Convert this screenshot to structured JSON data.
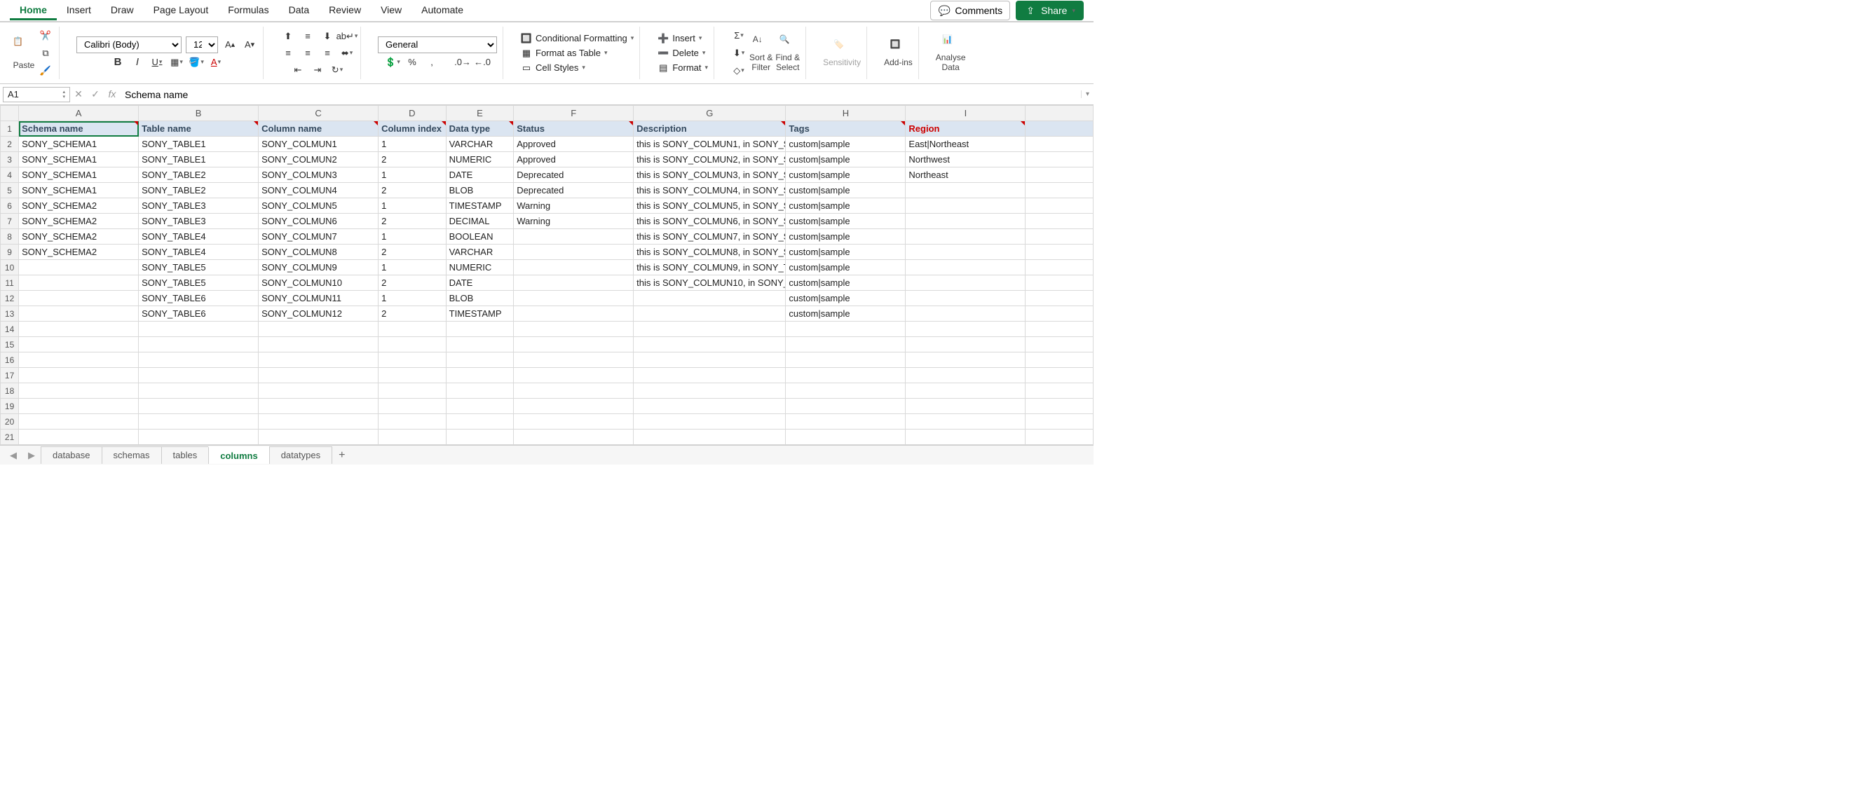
{
  "tabs": [
    "Home",
    "Insert",
    "Draw",
    "Page Layout",
    "Formulas",
    "Data",
    "Review",
    "View",
    "Automate"
  ],
  "active_tab": "Home",
  "actions": {
    "comments": "Comments",
    "share": "Share"
  },
  "clipboard": {
    "paste": "Paste"
  },
  "font": {
    "name": "Calibri (Body)",
    "size": "12"
  },
  "number_format": "General",
  "styles": {
    "cond_fmt": "Conditional Formatting",
    "as_table": "Format as Table",
    "cell_styles": "Cell Styles"
  },
  "cells": {
    "insert": "Insert",
    "delete": "Delete",
    "format": "Format"
  },
  "editing": {
    "sort_filter": "Sort &\nFilter",
    "find_select": "Find &\nSelect"
  },
  "extras": {
    "sensitivity": "Sensitivity",
    "addins": "Add-ins",
    "analyse": "Analyse\nData"
  },
  "name_box": "A1",
  "formula": "Schema name",
  "columns": [
    "A",
    "B",
    "C",
    "D",
    "E",
    "F",
    "G",
    "H",
    "I",
    ""
  ],
  "header_row": [
    "Schema name",
    "Table name",
    "Column name",
    "Column index",
    "Data type",
    "Status",
    "Description",
    "Tags",
    "Region"
  ],
  "region_col_index": 8,
  "data_rows": [
    [
      "SONY_SCHEMA1",
      "SONY_TABLE1",
      "SONY_COLMUN1",
      "1",
      "VARCHAR",
      "Approved",
      "this is SONY_COLMUN1, in SONY_S",
      "custom|sample",
      "East|Northeast"
    ],
    [
      "SONY_SCHEMA1",
      "SONY_TABLE1",
      "SONY_COLMUN2",
      "2",
      "NUMERIC",
      "Approved",
      "this is SONY_COLMUN2, in SONY_S",
      "custom|sample",
      "Northwest"
    ],
    [
      "SONY_SCHEMA1",
      "SONY_TABLE2",
      "SONY_COLMUN3",
      "1",
      "DATE",
      "Deprecated",
      "this is SONY_COLMUN3, in SONY_S",
      "custom|sample",
      "Northeast"
    ],
    [
      "SONY_SCHEMA1",
      "SONY_TABLE2",
      "SONY_COLMUN4",
      "2",
      "BLOB",
      "Deprecated",
      "this is SONY_COLMUN4, in SONY_S",
      "custom|sample",
      ""
    ],
    [
      "SONY_SCHEMA2",
      "SONY_TABLE3",
      "SONY_COLMUN5",
      "1",
      "TIMESTAMP",
      "Warning",
      "this is SONY_COLMUN5, in SONY_S",
      "custom|sample",
      ""
    ],
    [
      "SONY_SCHEMA2",
      "SONY_TABLE3",
      "SONY_COLMUN6",
      "2",
      "DECIMAL",
      "Warning",
      "this is SONY_COLMUN6, in SONY_S",
      "custom|sample",
      ""
    ],
    [
      "SONY_SCHEMA2",
      "SONY_TABLE4",
      "SONY_COLMUN7",
      "1",
      "BOOLEAN",
      "",
      "this is SONY_COLMUN7, in SONY_S",
      "custom|sample",
      ""
    ],
    [
      "SONY_SCHEMA2",
      "SONY_TABLE4",
      "SONY_COLMUN8",
      "2",
      "VARCHAR",
      "",
      "this is SONY_COLMUN8, in SONY_S",
      "custom|sample",
      ""
    ],
    [
      "",
      "SONY_TABLE5",
      "SONY_COLMUN9",
      "1",
      "NUMERIC",
      "",
      "this is SONY_COLMUN9, in SONY_T",
      "custom|sample",
      ""
    ],
    [
      "",
      "SONY_TABLE5",
      "SONY_COLMUN10",
      "2",
      "DATE",
      "",
      "this is SONY_COLMUN10, in SONY_",
      "custom|sample",
      ""
    ],
    [
      "",
      "SONY_TABLE6",
      "SONY_COLMUN11",
      "1",
      "BLOB",
      "",
      "",
      "custom|sample",
      ""
    ],
    [
      "",
      "SONY_TABLE6",
      "SONY_COLMUN12",
      "2",
      "TIMESTAMP",
      "",
      "",
      "custom|sample",
      ""
    ]
  ],
  "empty_rows": 8,
  "numeric_col_index": 3,
  "sheets": [
    "database",
    "schemas",
    "tables",
    "columns",
    "datatypes"
  ],
  "active_sheet": "columns"
}
